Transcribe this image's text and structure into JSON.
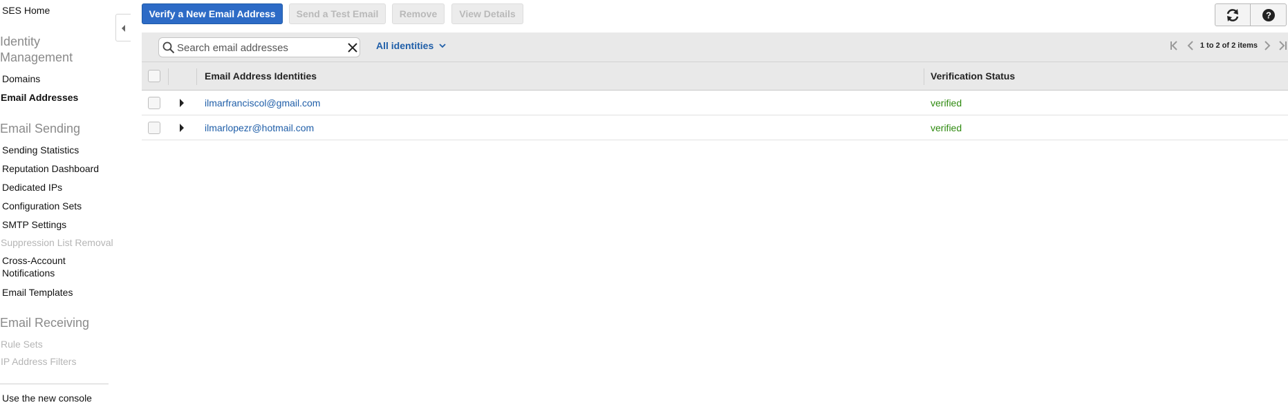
{
  "sidebar": {
    "home": "SES Home",
    "sections": [
      {
        "heading": "Identity Management",
        "items": [
          {
            "label": "Domains",
            "state": "normal"
          },
          {
            "label": "Email Addresses",
            "state": "active"
          }
        ]
      },
      {
        "heading": "Email Sending",
        "items": [
          {
            "label": "Sending Statistics",
            "state": "normal"
          },
          {
            "label": "Reputation Dashboard",
            "state": "normal"
          },
          {
            "label": "Dedicated IPs",
            "state": "normal"
          },
          {
            "label": "Configuration Sets",
            "state": "normal"
          },
          {
            "label": "SMTP Settings",
            "state": "normal"
          },
          {
            "label": "Suppression List Removal",
            "state": "disabled"
          },
          {
            "label": "Cross-Account Notifications",
            "state": "normal"
          },
          {
            "label": "Email Templates",
            "state": "normal"
          }
        ]
      },
      {
        "heading": "Email Receiving",
        "items": [
          {
            "label": "Rule Sets",
            "state": "disabled"
          },
          {
            "label": "IP Address Filters",
            "state": "disabled"
          }
        ]
      }
    ],
    "footer_link": "Use the new console",
    "collapse_icon": "triangle-left-icon"
  },
  "toolbar": {
    "verify_label": "Verify a New Email Address",
    "send_test_label": "Send a Test Email",
    "remove_label": "Remove",
    "view_details_label": "View Details",
    "refresh_icon": "refresh-icon",
    "help_icon": "help-icon"
  },
  "filter": {
    "search_placeholder": "Search email addresses",
    "search_value": "",
    "identities_label": "All identities",
    "pager_text": "1 to 2 of 2 items"
  },
  "table": {
    "columns": [
      "Email Address Identities",
      "Verification Status"
    ],
    "rows": [
      {
        "email": "ilmarfranciscol@gmail.com",
        "status": "verified"
      },
      {
        "email": "ilmarlopezr@hotmail.com",
        "status": "verified"
      }
    ]
  },
  "colors": {
    "primary": "#2d6bc6",
    "link": "#1f5ea8",
    "verified": "#2e8a0f",
    "header_bg": "#e9e9e9"
  }
}
